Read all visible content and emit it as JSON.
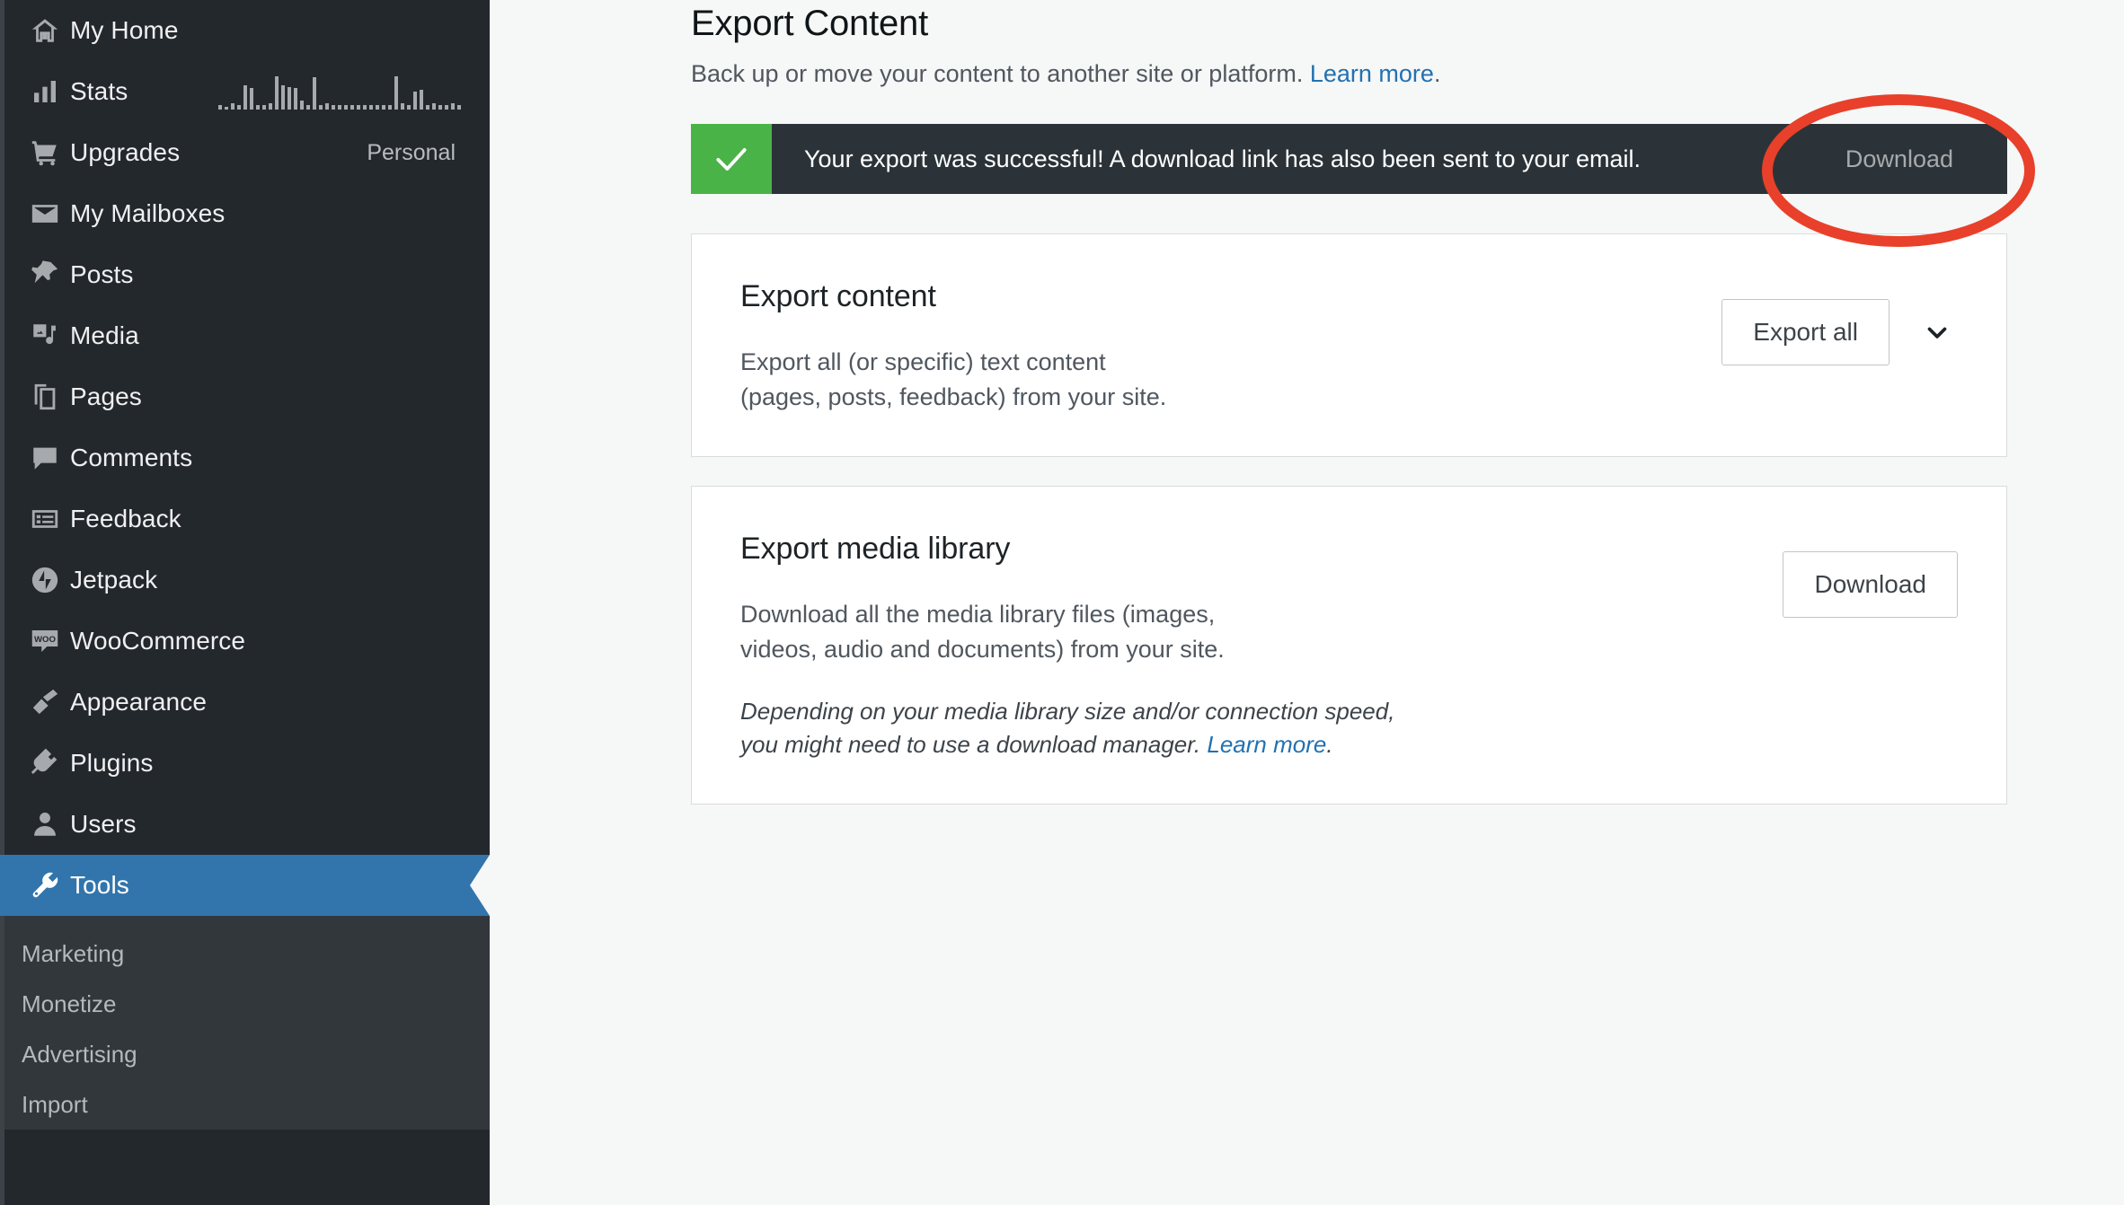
{
  "sidebar": {
    "items": [
      {
        "label": "My Home",
        "icon": "home-icon",
        "meta": ""
      },
      {
        "label": "Stats",
        "icon": "stats-icon",
        "meta": "",
        "sparkline": true
      },
      {
        "label": "Upgrades",
        "icon": "cart-icon",
        "meta": "Personal"
      },
      {
        "label": "My Mailboxes",
        "icon": "mail-icon",
        "meta": ""
      },
      {
        "label": "Posts",
        "icon": "pin-icon",
        "meta": ""
      },
      {
        "label": "Media",
        "icon": "media-icon",
        "meta": ""
      },
      {
        "label": "Pages",
        "icon": "pages-icon",
        "meta": ""
      },
      {
        "label": "Comments",
        "icon": "comment-icon",
        "meta": ""
      },
      {
        "label": "Feedback",
        "icon": "feedback-icon",
        "meta": ""
      },
      {
        "label": "Jetpack",
        "icon": "jetpack-icon",
        "meta": ""
      },
      {
        "label": "WooCommerce",
        "icon": "woocommerce-icon",
        "meta": ""
      },
      {
        "label": "Appearance",
        "icon": "brush-icon",
        "meta": ""
      },
      {
        "label": "Plugins",
        "icon": "plug-icon",
        "meta": ""
      },
      {
        "label": "Users",
        "icon": "user-icon",
        "meta": ""
      },
      {
        "label": "Tools",
        "icon": "wrench-icon",
        "meta": "",
        "active": true
      }
    ],
    "submenu": [
      {
        "label": "Marketing"
      },
      {
        "label": "Monetize"
      },
      {
        "label": "Advertising"
      },
      {
        "label": "Import"
      }
    ],
    "colors": {
      "background": "#23282d",
      "submenu_background": "#32373c",
      "active": "#3175ac"
    }
  },
  "main": {
    "title": "Export Content",
    "subtitle_text": "Back up or move your content to another site or platform.",
    "subtitle_link": "Learn more",
    "subtitle_period": ".",
    "notice": {
      "message": "Your export was successful! A download link has also been sent to your email.",
      "action_label": "Download",
      "icon": "checkmark-icon",
      "accent_color": "#4ab347",
      "background_color": "#2c3338"
    },
    "cards": [
      {
        "title": "Export content",
        "text_line1": "Export all (or specific) text content",
        "text_line2": "(pages, posts, feedback) from your site.",
        "button_label": "Export all",
        "has_chevron": true,
        "chevron_icon": "chevron-down-icon"
      },
      {
        "title": "Export media library",
        "text_line1": "Download all the media library files (images,",
        "text_line2": "videos, audio and documents) from your site.",
        "note_line1": "Depending on your media library size and/or connection speed,",
        "note_line2": "you might need to use a download manager.",
        "note_link": "Learn more",
        "note_period": ".",
        "button_label": "Download",
        "has_chevron": false
      }
    ]
  },
  "annotation": {
    "shape": "ellipse",
    "color": "#e8402a",
    "stroke_width": 12,
    "targets": "download-link-in-notice"
  }
}
